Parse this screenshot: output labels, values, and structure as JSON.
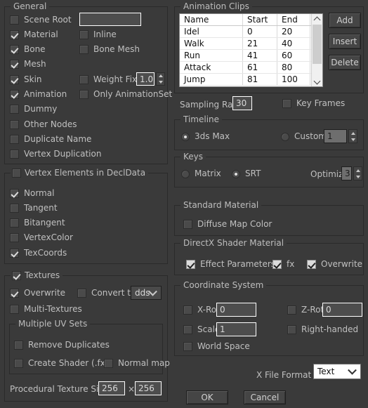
{
  "general": {
    "title": "General",
    "scene_root": {
      "label": "Scene Root",
      "checked": false,
      "value": ""
    },
    "checkboxes": [
      {
        "label": "Material",
        "checked": true
      },
      {
        "label": "Inline",
        "checked": false
      },
      {
        "label": "Bone",
        "checked": true
      },
      {
        "label": "Bone Mesh",
        "checked": false
      },
      {
        "label": "Mesh",
        "checked": true
      },
      {
        "label": "Skin",
        "checked": true
      },
      {
        "label": "Weight Fix",
        "checked": false
      },
      {
        "label": "Animation",
        "checked": true
      },
      {
        "label": "Only AnimationSet",
        "checked": false
      },
      {
        "label": "Dummy",
        "checked": false
      },
      {
        "label": "Other Nodes",
        "checked": false
      },
      {
        "label": "Duplicate Name",
        "checked": false
      },
      {
        "label": "Vertex Duplication",
        "checked": false
      }
    ],
    "weight_fix_value": "1.0"
  },
  "vertex_elements": {
    "title": "Vertex Elements in DeclData",
    "title_checked": false,
    "items": [
      {
        "label": "Normal",
        "checked": true
      },
      {
        "label": "Tangent",
        "checked": false
      },
      {
        "label": "Bitangent",
        "checked": false
      },
      {
        "label": "VertexColor",
        "checked": false
      },
      {
        "label": "TexCoords",
        "checked": true
      }
    ]
  },
  "textures": {
    "title": "Textures",
    "title_checked": true,
    "overwrite": {
      "label": "Overwrite",
      "checked": true
    },
    "convert_to": {
      "label": "Convert to",
      "checked": false,
      "value": "dds"
    },
    "multi_textures": {
      "label": "Multi-Textures",
      "checked": false
    },
    "uv_sets": {
      "title": "Multiple UV Sets",
      "items": [
        {
          "label": "Remove Duplicates",
          "checked": false
        },
        {
          "label": "Create Shader (.fx)",
          "checked": false
        },
        {
          "label": "Normal map",
          "checked": false
        }
      ]
    },
    "procedural": {
      "label": "Procedural Texture Size:",
      "width": "256",
      "separator": "×",
      "height": "256"
    }
  },
  "animation_clips": {
    "title": "Animation Clips",
    "columns": [
      "Name",
      "Start",
      "End",
      ""
    ],
    "rows": [
      [
        "Idel",
        "0",
        "20",
        ""
      ],
      [
        "Walk",
        "21",
        "40",
        ""
      ],
      [
        "Run",
        "41",
        "60",
        ""
      ],
      [
        "Attack",
        "61",
        "80",
        ""
      ],
      [
        "Jump",
        "81",
        "100",
        ""
      ]
    ],
    "buttons": [
      "Add",
      "Insert",
      "Delete"
    ]
  },
  "sampling": {
    "label": "Sampling Rate",
    "value": "30",
    "key_frames": {
      "label": "Key Frames",
      "checked": false
    }
  },
  "timeline": {
    "title": "Timeline",
    "options": [
      {
        "label": "3ds Max",
        "selected": true
      },
      {
        "label": "Custom",
        "selected": false
      }
    ],
    "custom_value": "1"
  },
  "keys": {
    "title": "Keys",
    "options": [
      {
        "label": "Matrix",
        "selected": false
      },
      {
        "label": "SRT",
        "selected": true
      }
    ],
    "optimize": {
      "label": "Optimize",
      "value": "3"
    }
  },
  "standard_material": {
    "title": "Standard Material",
    "diffuse_map_color": {
      "label": "Diffuse Map Color",
      "checked": false
    }
  },
  "directx_material": {
    "title": "DirectX Shader Material",
    "items": [
      {
        "label": "Effect Parameters",
        "checked": true
      },
      {
        "label": "fx",
        "checked": true
      },
      {
        "label": "Overwrite",
        "checked": true
      }
    ]
  },
  "coordinate_system": {
    "title": "Coordinate System",
    "x_rot": {
      "label": "X-Rot",
      "checked": false,
      "value": "0"
    },
    "z_rot": {
      "label": "Z-Rot",
      "checked": false,
      "value": "0"
    },
    "scale": {
      "label": "Scale",
      "checked": false,
      "value": "1"
    },
    "right_handed": {
      "label": "Right-handed",
      "checked": false
    },
    "world_space": {
      "label": "World Space",
      "checked": false
    }
  },
  "footer": {
    "x_file_format": {
      "label": "X File Format",
      "value": "Text"
    },
    "ok": "OK",
    "cancel": "Cancel"
  }
}
